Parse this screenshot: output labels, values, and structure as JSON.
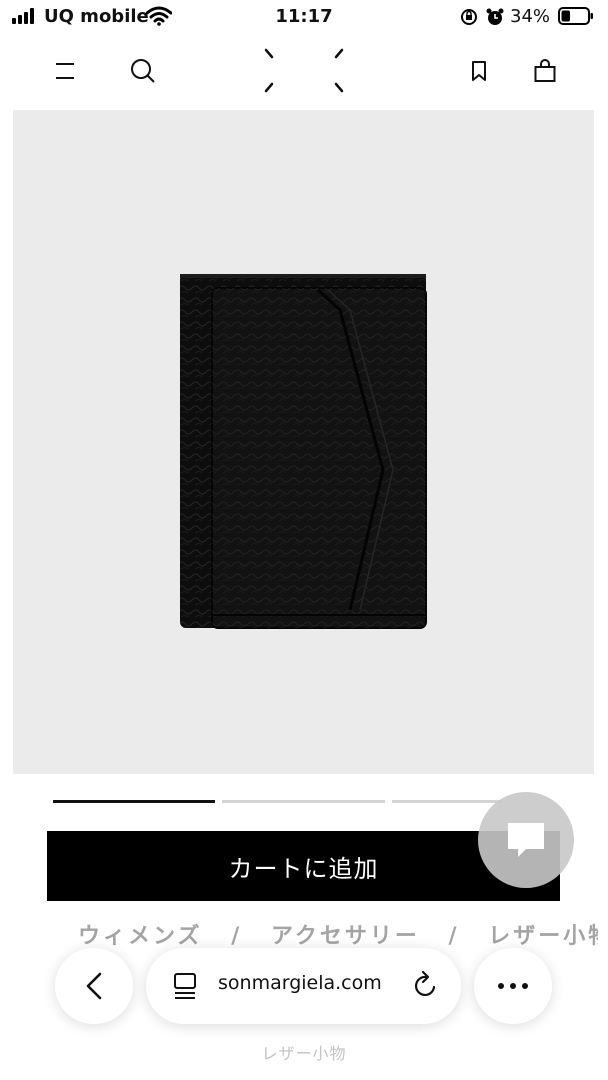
{
  "status_bar": {
    "carrier": "UQ mobile",
    "time": "11:17",
    "battery_percent": "34%",
    "battery_level": 0.34
  },
  "header": {
    "menu_icon": "menu-icon",
    "search_icon": "search-icon",
    "logo": "brand-logo-stitches",
    "bookmark_icon": "bookmark-icon",
    "bag_icon": "shopping-bag-icon"
  },
  "product": {
    "image": "black-leather-trifold-wallet",
    "background": "#ebebeb"
  },
  "carousel": {
    "slides": 3,
    "active_index": 0
  },
  "cart_button": {
    "label": "カートに追加"
  },
  "chat_button": {
    "icon": "chat-bubble-icon"
  },
  "breadcrumb": {
    "items": [
      "ウィメンズ",
      "アクセサリー",
      "レザー小物"
    ],
    "separator": "/"
  },
  "browser_bar": {
    "back_icon": "chevron-left-icon",
    "tabs_icon": "page-tabs-icon",
    "url": "sonmargiela.com",
    "reload_icon": "reload-icon",
    "more_icon": "more-dots-icon"
  },
  "bottom_label": "レザー小物"
}
